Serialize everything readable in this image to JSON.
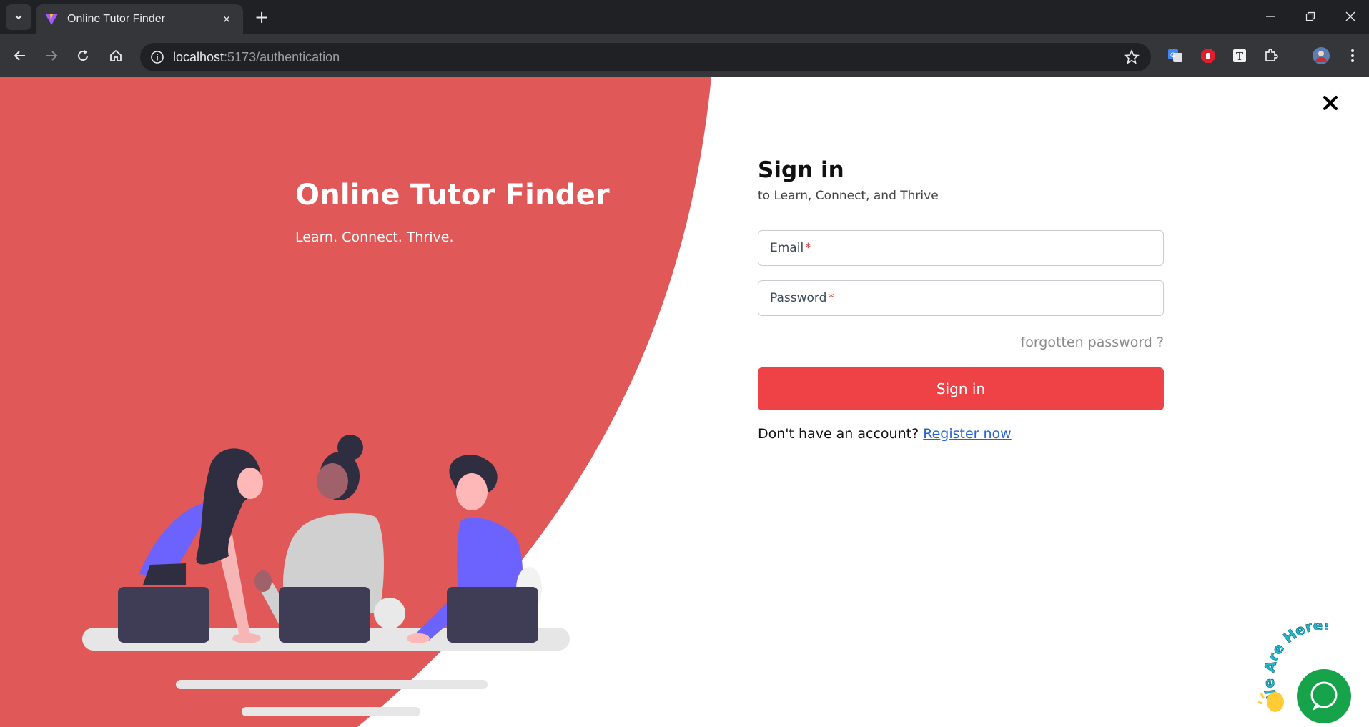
{
  "browser": {
    "tab_title": "Online Tutor Finder",
    "tab_close": "×",
    "new_tab": "+",
    "url_host": "localhost",
    "url_port": ":5173",
    "url_path": "/authentication",
    "window_controls": [
      "minimize-icon",
      "restore-icon",
      "close-icon"
    ],
    "extensions": [
      "translate-icon",
      "adblock-icon",
      "text-icon",
      "puzzle-icon",
      "profile-avatar"
    ]
  },
  "hero": {
    "title": "Online Tutor Finder",
    "subtitle": "Learn. Connect. Thrive.",
    "accent_color": "#e05858"
  },
  "signin": {
    "title": "Sign in",
    "subtitle": "to Learn, Connect, and Thrive",
    "email_label": "Email",
    "password_label": "Password",
    "required_mark": "*",
    "forgot": "forgotten password ?",
    "button": "Sign in",
    "no_account": "Don't have an account?",
    "register": "Register now",
    "button_color": "#ee4246"
  },
  "chat_widget": {
    "badge_text": "We Are Here!",
    "color": "#16a34a"
  }
}
